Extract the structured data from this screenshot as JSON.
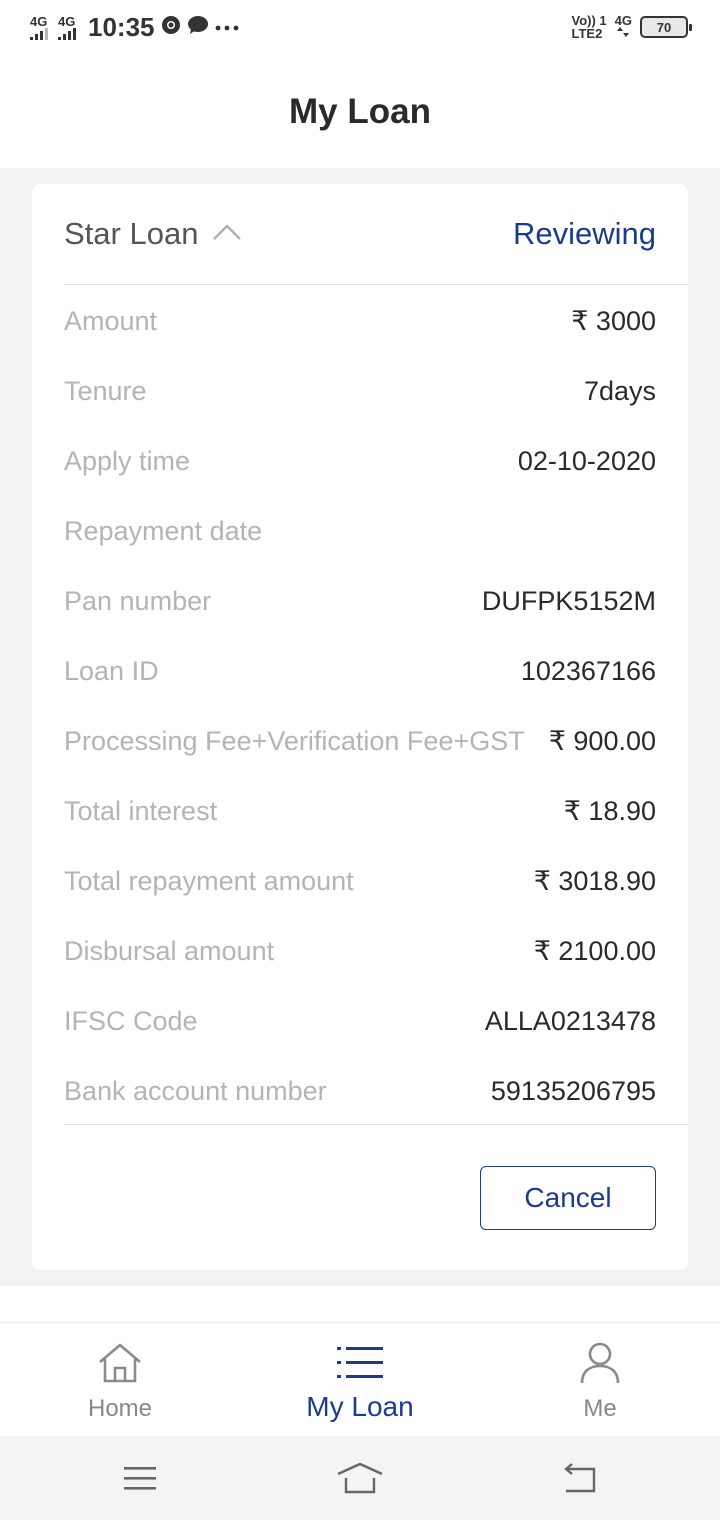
{
  "status_bar": {
    "sim1_network": "4G",
    "sim2_network": "4G",
    "time": "10:35",
    "volte_label_top": "Vo)) 1",
    "volte_label_bottom": "LTE2",
    "network_right": "4G",
    "battery": "70",
    "icons": [
      "chrome-icon",
      "chat-bubble-icon",
      "more-dots-icon"
    ]
  },
  "header": {
    "title": "My Loan"
  },
  "loan_card": {
    "product_name": "Star Loan",
    "status": "Reviewing",
    "rows": [
      {
        "label": "Amount",
        "value": "₹ 3000"
      },
      {
        "label": "Tenure",
        "value": "7days"
      },
      {
        "label": "Apply time",
        "value": "02-10-2020"
      },
      {
        "label": "Repayment date",
        "value": ""
      },
      {
        "label": "Pan number",
        "value": "DUFPK5152M"
      },
      {
        "label": "Loan ID",
        "value": "102367166"
      },
      {
        "label": "Processing Fee+Verification Fee+GST",
        "value": "₹ 900.00"
      },
      {
        "label": "Total interest",
        "value": "₹ 18.90"
      },
      {
        "label": "Total repayment amount",
        "value": "₹ 3018.90"
      },
      {
        "label": "Disbursal amount",
        "value": "₹ 2100.00"
      },
      {
        "label": "IFSC Code",
        "value": "ALLA0213478"
      },
      {
        "label": "Bank account number",
        "value": "59135206795"
      }
    ],
    "cancel_label": "Cancel"
  },
  "tabs": [
    {
      "label": "Home",
      "icon": "home-icon",
      "active": false
    },
    {
      "label": "My Loan",
      "icon": "list-icon",
      "active": true
    },
    {
      "label": "Me",
      "icon": "person-icon",
      "active": false
    }
  ],
  "colors": {
    "accent": "#1c3b8f",
    "label_gray": "#b4b4b4",
    "background": "#f2f2f2"
  }
}
